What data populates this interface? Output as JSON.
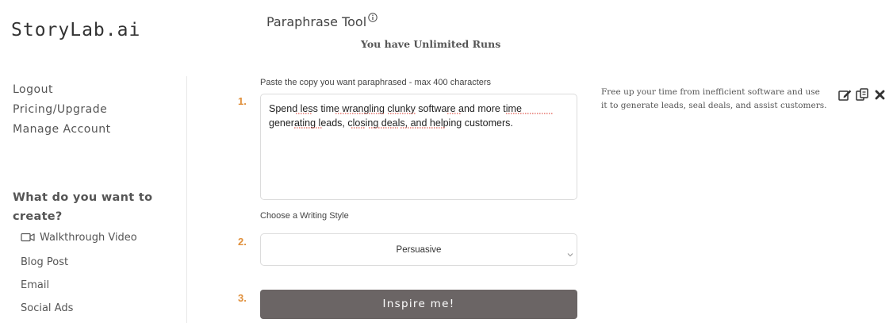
{
  "brand": {
    "logo_text": "StoryLab.ai"
  },
  "sidebar": {
    "links": [
      {
        "label": "Logout"
      },
      {
        "label": "Pricing/Upgrade"
      },
      {
        "label": "Manage Account"
      }
    ],
    "create_heading": "What do you want to create?",
    "walkthrough": {
      "label": "Walkthrough Video",
      "icon": "video-camera-icon"
    },
    "items": [
      {
        "label": "Blog Post"
      },
      {
        "label": "Email"
      },
      {
        "label": "Social Ads"
      }
    ]
  },
  "header": {
    "title": "Paraphrase Tool",
    "runs_text": "You have Unlimited Runs",
    "info_icon": "info-icon"
  },
  "form": {
    "step1": "1.",
    "step2": "2.",
    "step3": "3.",
    "input_label": "Paste the copy you want paraphrased - max 400 characters",
    "input_value": "Spend less time wrangling clunky software and more time generating leads, closing deals, and helping customers.",
    "style_label": "Choose a Writing Style",
    "style_value": "Persuasive",
    "submit_label": "Inspire me!"
  },
  "result": {
    "text": "Free up your time from inefficient software and use it to generate leads, seal deals, and assist customers.",
    "actions": [
      "edit-icon",
      "copy-icon",
      "close-icon"
    ]
  },
  "colors": {
    "step_number": "#e0903c",
    "button_bg": "#6b6565",
    "spellcheck_underline": "#d93025"
  }
}
